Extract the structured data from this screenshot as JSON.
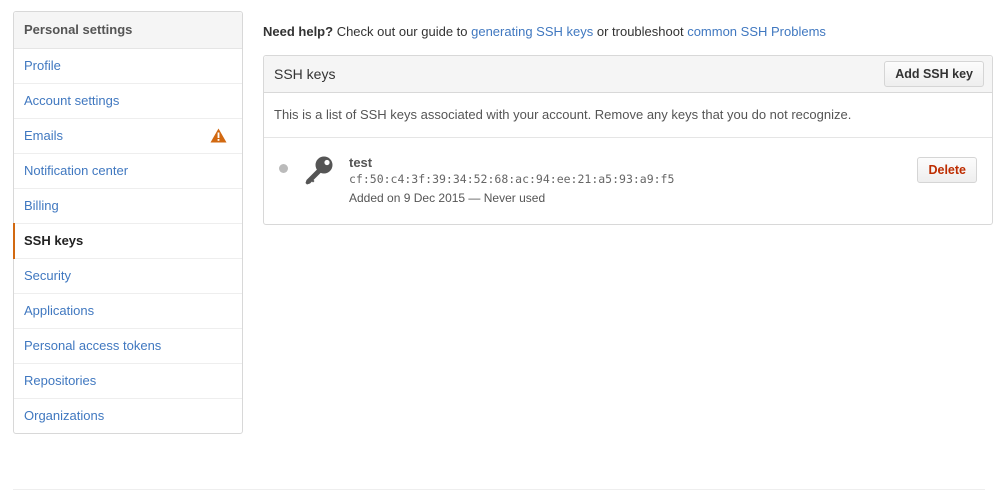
{
  "sidebar": {
    "header": "Personal settings",
    "items": [
      {
        "label": "Profile"
      },
      {
        "label": "Account settings"
      },
      {
        "label": "Emails"
      },
      {
        "label": "Notification center"
      },
      {
        "label": "Billing"
      },
      {
        "label": "SSH keys"
      },
      {
        "label": "Security"
      },
      {
        "label": "Applications"
      },
      {
        "label": "Personal access tokens"
      },
      {
        "label": "Repositories"
      },
      {
        "label": "Organizations"
      }
    ],
    "selected_item": "SSH keys",
    "emails_warning_icon": "warning-icon",
    "accent_color": "#d26911"
  },
  "help": {
    "prefix_bold": "Need help?",
    "text1": " Check out our guide to ",
    "link1": "generating SSH keys",
    "text2": " or troubleshoot ",
    "link2": "common SSH Problems"
  },
  "panel": {
    "title": "SSH keys",
    "add_button": "Add SSH key",
    "description": "This is a list of SSH keys associated with your account. Remove any keys that you do not recognize.",
    "keys": [
      {
        "title": "test",
        "fingerprint": "cf:50:c4:3f:39:34:52:68:ac:94:ee:21:a5:93:a9:f5",
        "added": "Added on 9 Dec 2015 — Never used",
        "delete_label": "Delete",
        "icon": "key-icon"
      }
    ]
  },
  "colors": {
    "link": "#4078c0",
    "danger": "#bd2c00",
    "warning": "#d26911"
  }
}
